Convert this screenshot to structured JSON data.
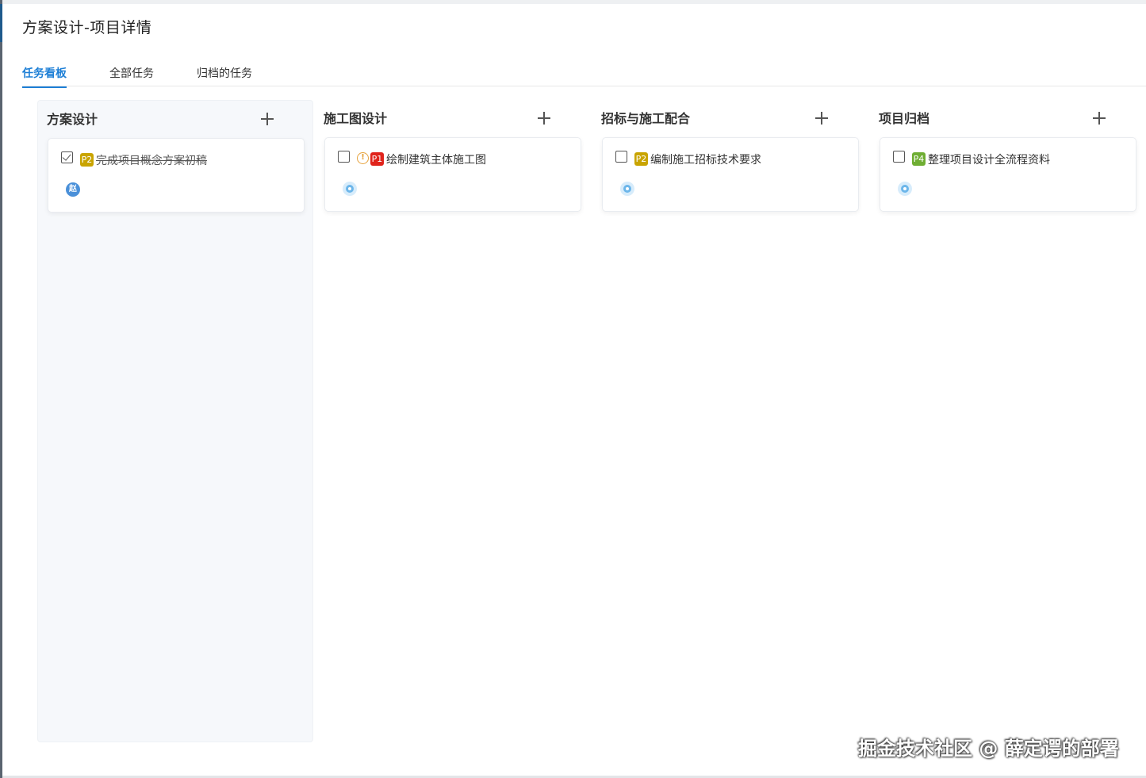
{
  "page": {
    "title": "方案设计-项目详情"
  },
  "tabs": [
    {
      "label": "任务看板",
      "active": true
    },
    {
      "label": "全部任务",
      "active": false
    },
    {
      "label": "归档的任务",
      "active": false
    }
  ],
  "columns": [
    {
      "title": "方案设计",
      "add_icon": "plus-icon",
      "card": {
        "checked": true,
        "warning": false,
        "priority": "P2",
        "priority_color": "#c9a400",
        "text": "完成项目概念方案初稿",
        "avatar": "赵"
      }
    },
    {
      "title": "施工图设计",
      "add_icon": "plus-icon",
      "card": {
        "checked": false,
        "warning": true,
        "warning_glyph": "!",
        "priority": "P1",
        "priority_color": "#e0231b",
        "text": "绘制建筑主体施工图",
        "avatar": ""
      }
    },
    {
      "title": "招标与施工配合",
      "add_icon": "plus-icon",
      "card": {
        "checked": false,
        "warning": false,
        "priority": "P2",
        "priority_color": "#c9a400",
        "text": "编制施工招标技术要求",
        "avatar": ""
      }
    },
    {
      "title": "项目归档",
      "add_icon": "plus-icon",
      "card": {
        "checked": false,
        "warning": false,
        "priority": "P4",
        "priority_color": "#6fae33",
        "text": "整理项目设计全流程资料",
        "avatar": ""
      }
    }
  ],
  "watermark": "掘金技术社区 @ 薛定谔的部署",
  "colors": {
    "accent": "#1d7fd6"
  }
}
